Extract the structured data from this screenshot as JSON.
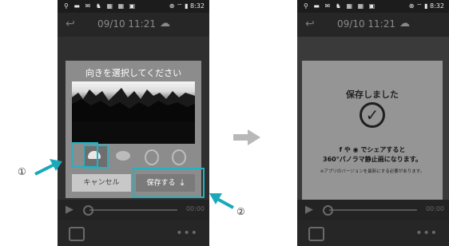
{
  "left_phone": {
    "status_left_icons": "⚲ ▬ ✉ ♞ ▦ ▦ ▣",
    "status_right": "⊕ ⌔ ▮ 8:32",
    "appbar_title": "09/10 11:21",
    "dialog": {
      "title": "向きを選択してください",
      "cancel_label": "キャンセル",
      "save_label": "保存する",
      "orientations": [
        "dome-up",
        "dome-flat",
        "side-left",
        "side-right"
      ]
    },
    "playbar_time": "00:00"
  },
  "right_phone": {
    "status_left_icons": "⚲ ▬ ✉ ♞ ▦ ▦ ▣",
    "status_right": "⊕ ⌔ ▮ 8:32",
    "appbar_title": "09/10 11:21",
    "modal": {
      "title": "保存しました",
      "share_line1": "f や ◉ でシェアすると",
      "share_line2": "360°パノラマ静止画になります。",
      "note": "※アプリのバージョンを最新にする必要があります。"
    },
    "playbar_time": "00:00"
  },
  "callouts": {
    "one": "①",
    "two": "②"
  },
  "colors": {
    "highlight": "#1fb3c4",
    "arrow_gray": "#b8b8b8"
  }
}
